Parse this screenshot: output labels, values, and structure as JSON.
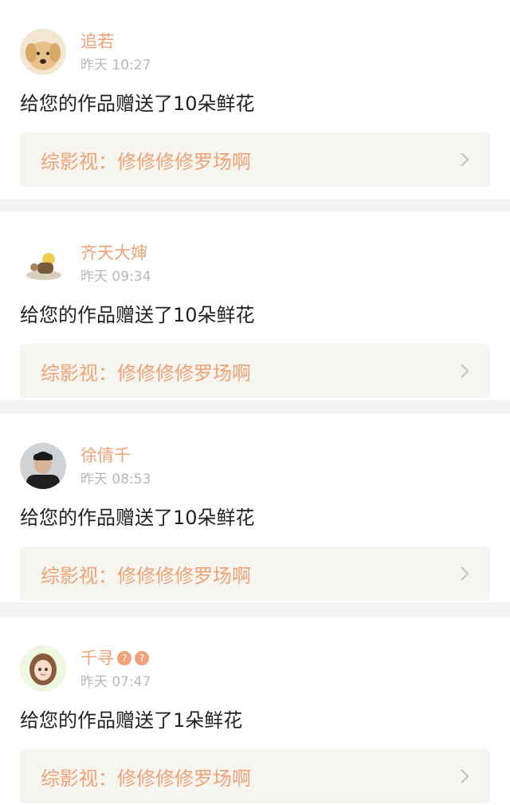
{
  "colors": {
    "accent": "#f0a276",
    "time": "#b8b8b8",
    "link_bg": "#f6f5ef",
    "divider": "#f4f4f4",
    "indicator": "#f0a3ba"
  },
  "notifications": [
    {
      "user": "追若",
      "time": "昨天 10:27",
      "message": "给您的作品赠送了10朵鲜花",
      "work": "综影视：修修修修罗场啊",
      "avatar": "dog-avatar",
      "badges": []
    },
    {
      "user": "齐天大婶",
      "time": "昨天 09:34",
      "message": "给您的作品赠送了10朵鲜花",
      "work": "综影视：修修修修罗场啊",
      "avatar": "cartoon-figure-avatar",
      "badges": []
    },
    {
      "user": "徐倩千",
      "time": "昨天 08:53",
      "message": "给您的作品赠送了10朵鲜花",
      "work": "综影视：修修修修罗场啊",
      "avatar": "man-portrait-avatar",
      "badges": []
    },
    {
      "user": "千寻",
      "time": "昨天 07:47",
      "message": "给您的作品赠送了1朵鲜花",
      "work": "综影视：修修修修罗场啊",
      "avatar": "anime-girl-avatar",
      "badges": [
        "?",
        "?"
      ]
    }
  ]
}
